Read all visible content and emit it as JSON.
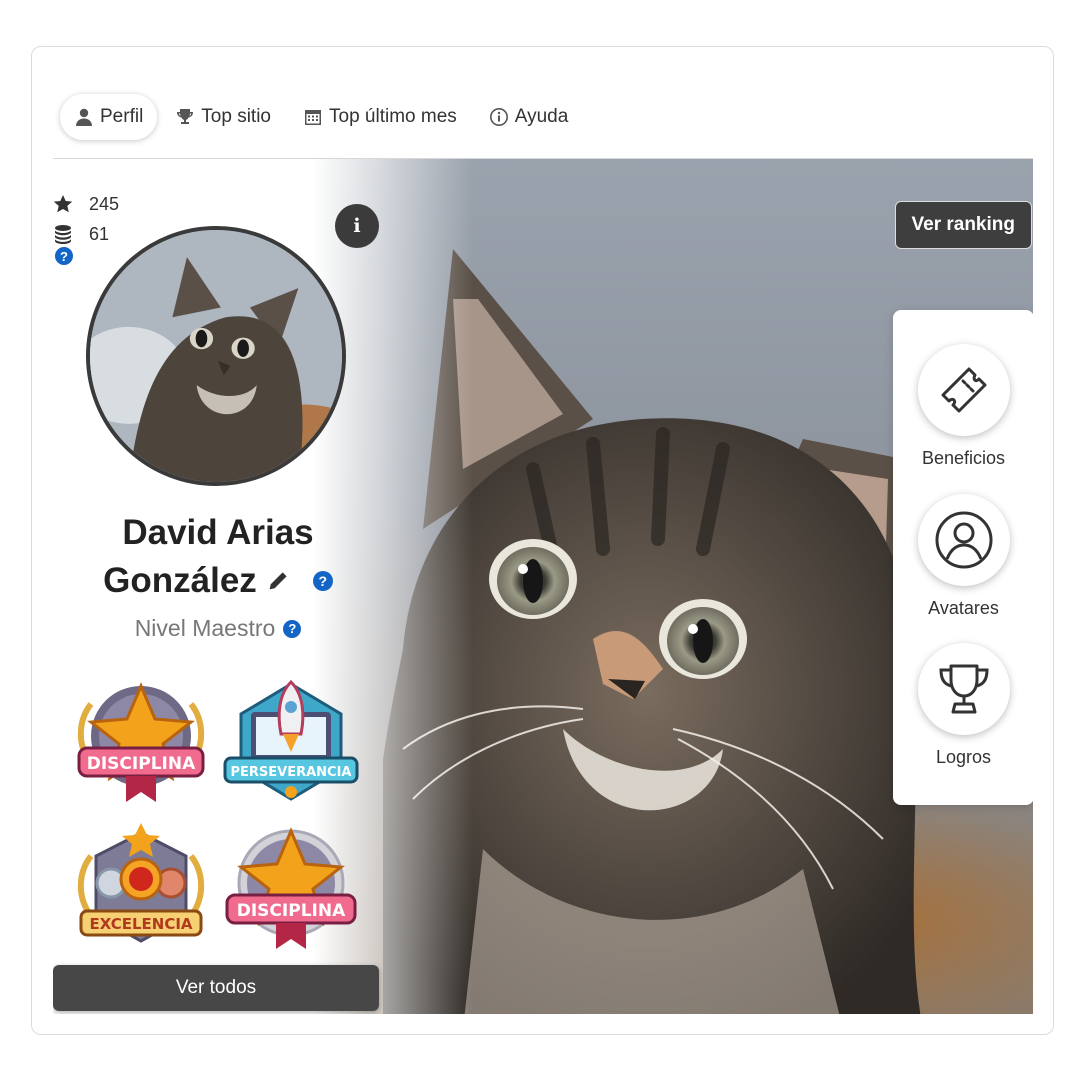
{
  "tabs": [
    {
      "label": "Perfil",
      "icon": "user-icon",
      "active": true
    },
    {
      "label": "Top sitio",
      "icon": "trophy-icon"
    },
    {
      "label": "Top último mes",
      "icon": "calendar-icon"
    },
    {
      "label": "Ayuda",
      "icon": "info-circle-icon"
    }
  ],
  "stats": {
    "points": "245",
    "coins": "61"
  },
  "profile": {
    "name_line1": "David Arias",
    "name_line2": "González",
    "level": "Nivel Maestro"
  },
  "badges": [
    {
      "label": "DISCIPLINA"
    },
    {
      "label": "PERSEVERANCIA"
    },
    {
      "label": "EXCELENCIA"
    },
    {
      "label": "DISCIPLINA"
    }
  ],
  "buttons": {
    "ver_todos": "Ver todos",
    "ver_ranking": "Ver ranking",
    "info": "i"
  },
  "side_panel": [
    {
      "label": "Beneficios",
      "icon": "ticket-icon"
    },
    {
      "label": "Avatares",
      "icon": "avatar-icon"
    },
    {
      "label": "Logros",
      "icon": "trophy-icon"
    }
  ],
  "help_mark": "?",
  "colors": {
    "help_blue": "#1466c6",
    "button_dark": "#474747",
    "accent_gold": "#f2a31b"
  }
}
